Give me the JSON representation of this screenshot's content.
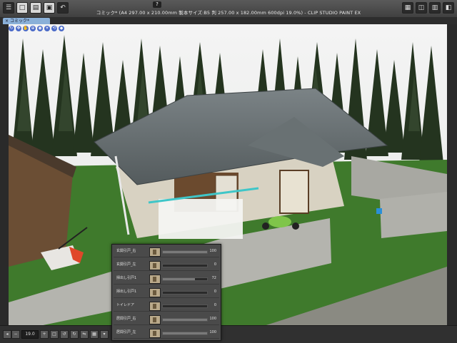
{
  "window": {
    "title": "コミック* (A4 297.00 x 210.00mm 製本サイズ:B5 判 257.00 x 182.00mm 600dpi 19.0%) - CLIP STUDIO PAINT EX"
  },
  "tab": {
    "label": "コミック*",
    "close_glyph": "×"
  },
  "status": {
    "zoom": "19.0"
  },
  "panel": {
    "rows": [
      {
        "label": "玄関引戸_右",
        "value": "100",
        "level": 1.0
      },
      {
        "label": "玄関引戸_左",
        "value": "0",
        "level": 0.0
      },
      {
        "label": "掃出し引戸1",
        "value": "72",
        "level": 0.72
      },
      {
        "label": "掃出し引戸1",
        "value": "0",
        "level": 0.0
      },
      {
        "label": "トイレドア",
        "value": "0",
        "level": 0.0
      },
      {
        "label": "居間引戸_右",
        "value": "100",
        "level": 1.0
      },
      {
        "label": "居間引戸_左",
        "value": "100",
        "level": 1.0
      }
    ]
  },
  "colors": {
    "tab_active": "#8ab0d8",
    "nav_controls": "#4a6ac8",
    "grass": "#3f7a2c",
    "roof": "#5c6466"
  },
  "icons": [
    "new-icon",
    "open-icon",
    "save-icon",
    "help-icon",
    "close-tab-icon",
    "rotate-icon",
    "move-icon",
    "zoom-icon"
  ]
}
